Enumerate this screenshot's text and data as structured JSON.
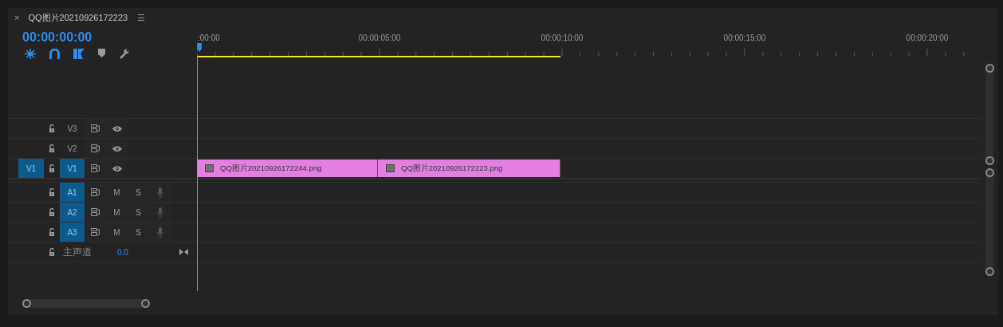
{
  "tab": {
    "close": "×",
    "title": "QQ图片20210926172223",
    "menu": "☰"
  },
  "timecode": "00:00:00:00",
  "ruler": {
    "labels": [
      ":00:00",
      "00:00:05:00",
      "00:00:10:00",
      "00:00:15:00",
      "00:00:20:00"
    ]
  },
  "video_tracks": [
    {
      "label": "V3",
      "targeted": false
    },
    {
      "label": "V2",
      "targeted": false
    },
    {
      "source_patch": "V1",
      "label": "V1",
      "targeted": true,
      "clips": [
        {
          "name": "QQ图片20210926172244.png"
        },
        {
          "name": "QQ图片20210926172223.png"
        }
      ]
    }
  ],
  "audio_tracks": [
    {
      "label": "A1",
      "targeted": true,
      "mute": "M",
      "solo": "S"
    },
    {
      "label": "A2",
      "targeted": true,
      "mute": "M",
      "solo": "S"
    },
    {
      "label": "A3",
      "targeted": true,
      "mute": "M",
      "solo": "S"
    }
  ],
  "master": {
    "label": "主声道",
    "value": "0.0"
  }
}
